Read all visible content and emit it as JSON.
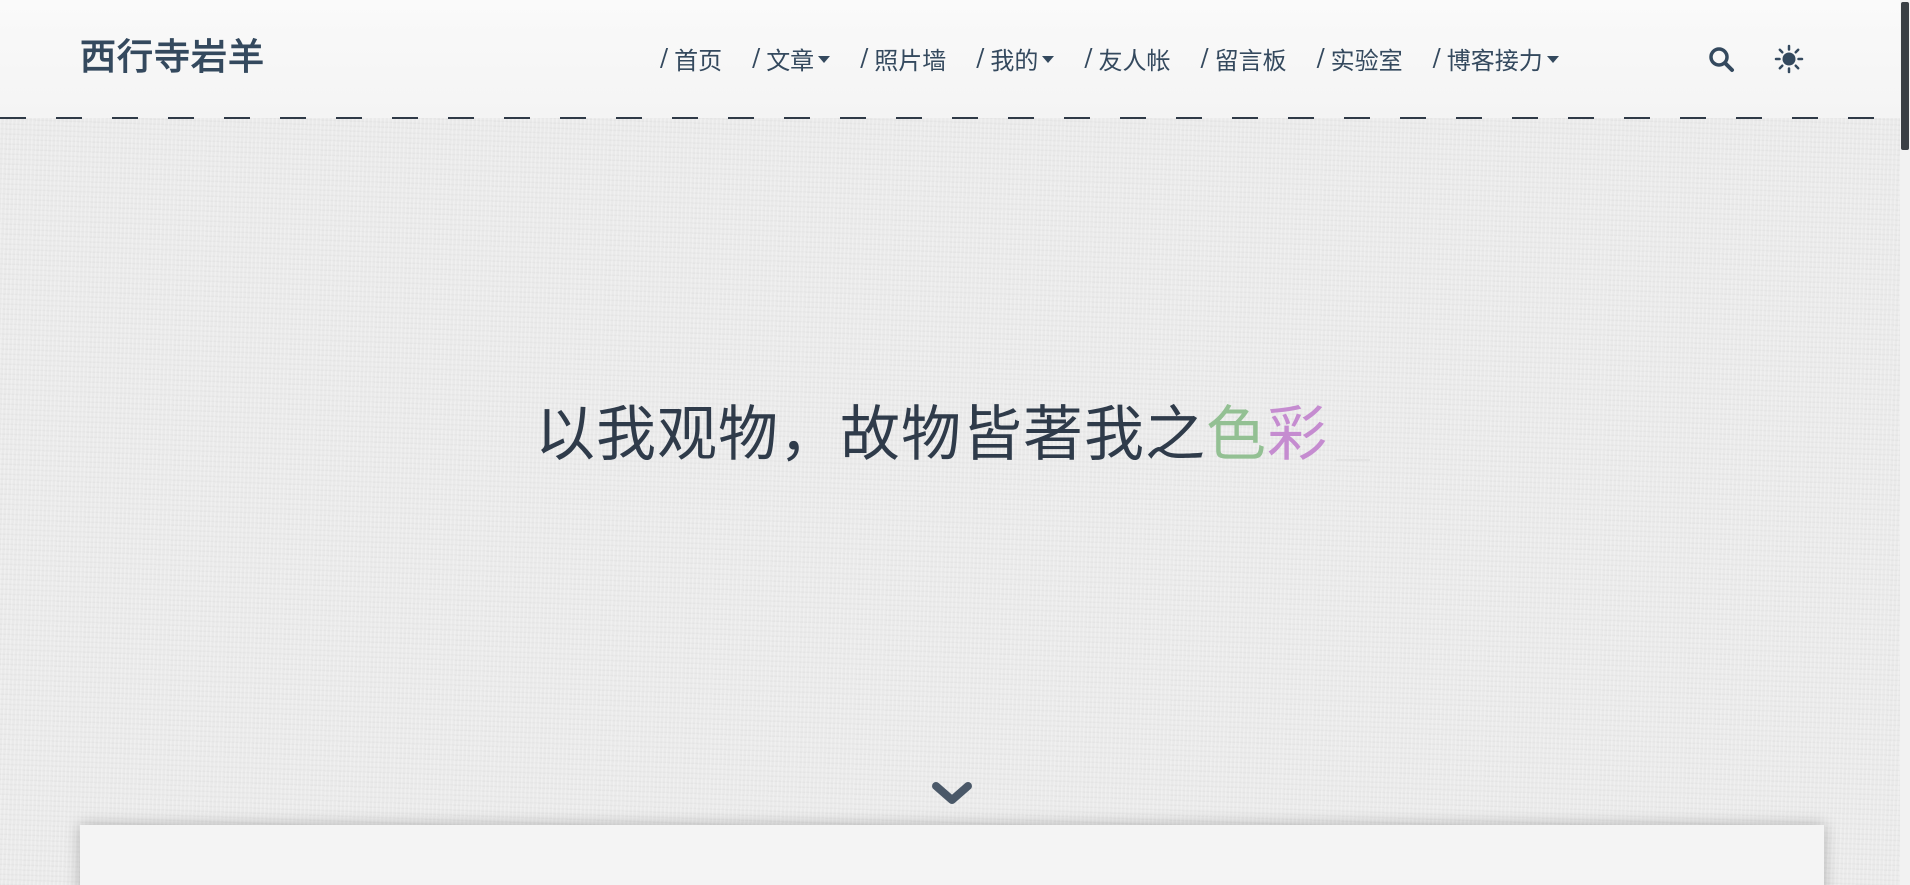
{
  "header": {
    "brand": "西行寺岩羊",
    "nav": [
      {
        "label": "首页",
        "dropdown": false
      },
      {
        "label": "文章",
        "dropdown": true
      },
      {
        "label": "照片墙",
        "dropdown": false
      },
      {
        "label": "我的",
        "dropdown": true
      },
      {
        "label": "友人帐",
        "dropdown": false
      },
      {
        "label": "留言板",
        "dropdown": false
      },
      {
        "label": "实验室",
        "dropdown": false
      },
      {
        "label": "博客接力",
        "dropdown": true
      }
    ],
    "nav_separator": "/",
    "icons": [
      "search-icon",
      "sun-icon"
    ]
  },
  "hero": {
    "text_main": "以我观物，故物皆著我之",
    "text_green": "色",
    "text_purple": "彩"
  },
  "colors": {
    "text": "#34495e",
    "accent_green": "#93c093",
    "accent_purple": "#c58cd0",
    "background": "#ebebeb"
  },
  "icons": {
    "scroll_down": "chevron-down-icon"
  }
}
